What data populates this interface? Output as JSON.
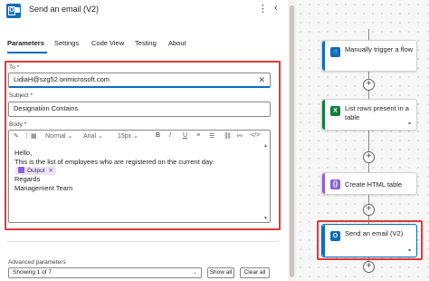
{
  "header": {
    "title": "Send an email (V2)",
    "more_icon": "more-vertical-icon",
    "collapse_icon": "chevron-left-icon"
  },
  "tabs": [
    {
      "label": "Parameters",
      "active": true
    },
    {
      "label": "Settings"
    },
    {
      "label": "Code View"
    },
    {
      "label": "Testing"
    },
    {
      "label": "About"
    }
  ],
  "to": {
    "label": "To *",
    "value": "LidiaH@szg52.onmicrosoft.com"
  },
  "subject": {
    "label": "Subject *",
    "value": "Designation Contains"
  },
  "body": {
    "label": "Body *",
    "toolbar": {
      "font_style": "Normal",
      "font_family": "Arial",
      "font_size": "15px",
      "bold": "B",
      "italic": "I",
      "underline": "U"
    },
    "lines": [
      "Hello,",
      "This is the list of employees who are registered on the current day."
    ],
    "token": "Output",
    "closing": [
      "Regards",
      "Management Team"
    ]
  },
  "advanced": {
    "label": "Advanced parameters",
    "selected": "Showing 1 of 7",
    "show_all": "Show all",
    "clear_all": "Clear all"
  },
  "flow": {
    "cards": [
      {
        "title": "Manually trigger a flow",
        "color": "#0f6cbd",
        "icon": "trigger-hand-icon"
      },
      {
        "title": "List rows present in a table",
        "color": "#107c41",
        "icon": "excel-icon"
      },
      {
        "title": "Create HTML table",
        "color": "#8e5fd6",
        "icon": "data-operation-icon"
      },
      {
        "title": "Send an email (V2)",
        "color": "#0f6cbd",
        "icon": "outlook-icon"
      }
    ]
  },
  "colors": {
    "accent": "#0f6cbd",
    "highlight": "#e03a3a"
  }
}
